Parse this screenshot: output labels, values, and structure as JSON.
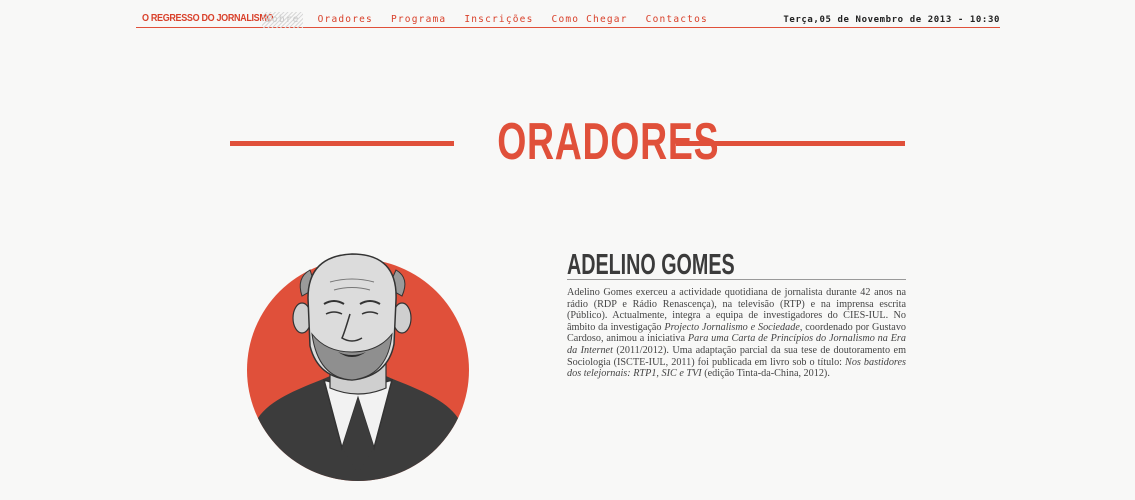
{
  "header": {
    "brand": "O REGRESSO DO JORNALISMO",
    "nav": [
      {
        "label": "Sobre",
        "active": true
      },
      {
        "label": "Oradores",
        "active": false
      },
      {
        "label": "Programa",
        "active": false
      },
      {
        "label": "Inscrições",
        "active": false
      },
      {
        "label": "Como Chegar",
        "active": false
      },
      {
        "label": "Contactos",
        "active": false
      }
    ],
    "datetime": "Terça,05 de Novembro de 2013 - 10:30"
  },
  "page": {
    "section_title": "ORADORES"
  },
  "speaker": {
    "name": "ADELINO GOMES",
    "bio": {
      "p1": "Adelino Gomes exerceu a actividade quotidiana de jornalista durante 42 anos na rádio (RDP e Rádio Renascença), na televisão (RTP) e na imprensa escrita (Público). Actualmente, integra a equipa de investigadores do CIES-IUL. No âmbito da investigação ",
      "i1": "Projecto Jornalismo e Sociedade",
      "p2": ", coordenado por Gustavo Cardoso, animou a iniciativa ",
      "i2": "Para uma Carta de Princípios do Jornalismo na Era da Internet",
      "p3": " (2011/2012). Uma adaptação parcial da sua tese de doutoramento em Sociologia (ISCTE-IUL, 2011) foi publicada em livro sob o título: ",
      "i3": "Nos bastidores dos telejornais: RTP1, SIC e TVI",
      "p4": " (edição Tinta-da-China, 2012)."
    }
  },
  "colors": {
    "accent": "#e0503a",
    "background": "#f8f8f7"
  }
}
